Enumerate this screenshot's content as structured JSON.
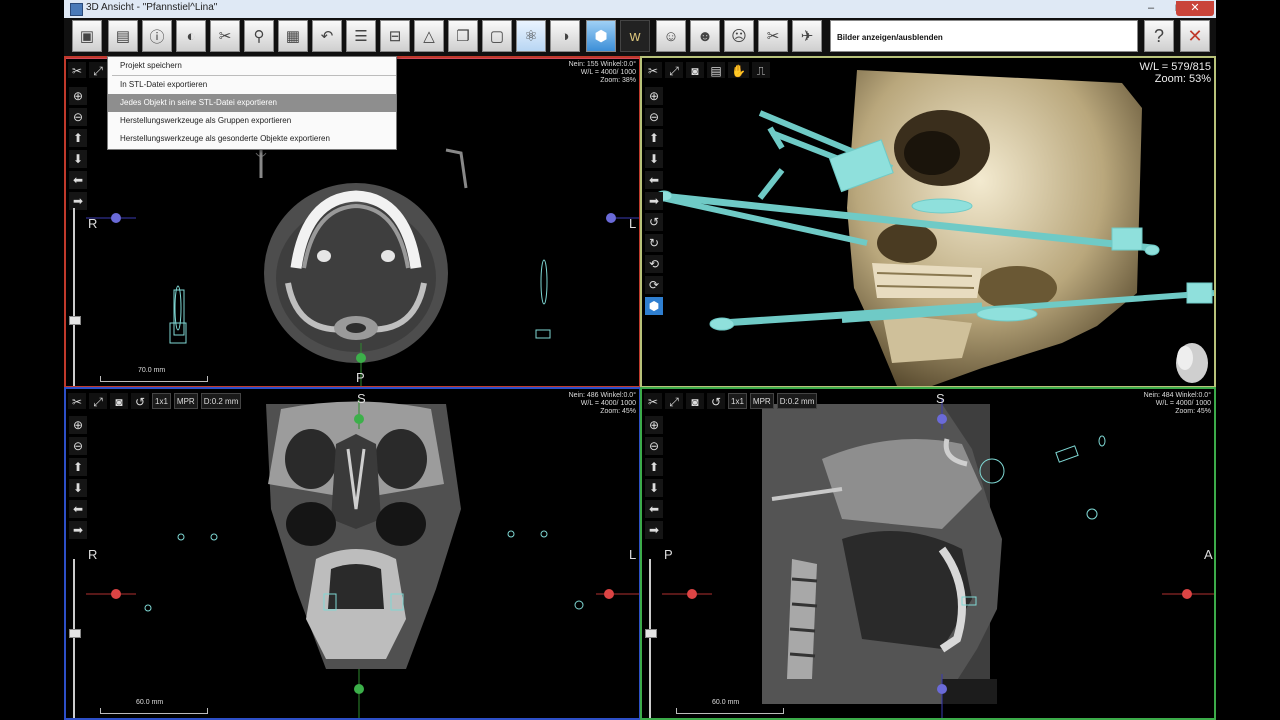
{
  "window": {
    "title": "3D Ansicht  -  \"Pfannstiel^Lina\"",
    "minimize": "–",
    "maximize": "□",
    "close": "✕"
  },
  "toolbar": {
    "toggle_images_label": "Bilder anzeigen/ausblenden",
    "help_icon": "?",
    "close_icon": "✕"
  },
  "menu": {
    "items": [
      "Projekt speichern",
      "In STL-Datei exportieren",
      "Jedes Objekt in seine STL-Datei exportieren",
      "Herstellungswerkzeuge als Gruppen exportieren",
      "Herstellungswerkzeuge als gesonderte Objekte exportieren"
    ],
    "highlighted_index": 2
  },
  "panels": {
    "axial": {
      "info": [
        "Nein: 155 Winkel:0.0°",
        "W/L = 4000/ 1000",
        "Zoom: 38%"
      ],
      "orient_left": "R",
      "orient_right": "L",
      "orient_bottom": "P",
      "scale": "70.0 mm"
    },
    "render3d": {
      "info": [
        "W/L = 579/815",
        "Zoom: 53%"
      ]
    },
    "coronal": {
      "buttons": [
        "1x1",
        "MPR",
        "D:0.2 mm"
      ],
      "info": [
        "Nein: 486 Winkel:0.0°",
        "W/L = 4000/ 1000",
        "Zoom: 45%"
      ],
      "orient_top": "S",
      "orient_left": "R",
      "orient_right": "L",
      "scale": "60.0 mm"
    },
    "sagittal": {
      "buttons": [
        "1x1",
        "MPR",
        "D:0.2 mm"
      ],
      "info": [
        "Nein: 484 Winkel:0.0°",
        "W/L = 4000/ 1000",
        "Zoom: 45%"
      ],
      "orient_top": "S",
      "orient_left": "P",
      "orient_right": "A",
      "scale": "60.0 mm"
    }
  },
  "colors": {
    "axial_border": "#c0392b",
    "render_border": "#b8c27a",
    "coronal_border": "#2d4fc7",
    "sagittal_border": "#3cab4a",
    "implant": "#7fd8d4"
  }
}
